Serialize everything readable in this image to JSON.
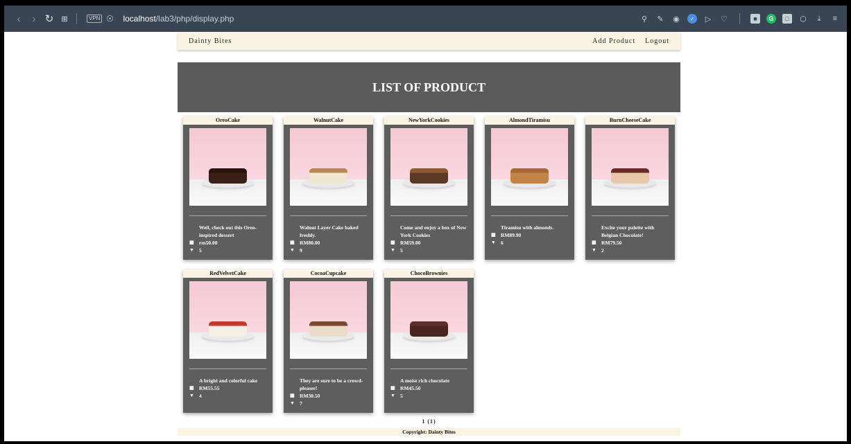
{
  "browser": {
    "url_host": "localhost",
    "url_path": "/lab3/php/display.php",
    "vpn_label": "VPN"
  },
  "nav": {
    "brand": "Dainty Bites",
    "add_product": "Add Product",
    "logout": "Logout"
  },
  "banner": {
    "title": "LIST OF PRODUCT"
  },
  "products": [
    {
      "name": "OreoCake",
      "desc": "Well, check out this Oreo-inspired dessert",
      "price": "rm50.00",
      "qty": "5",
      "cake_color": "#3b1f17",
      "cake_top": "#2a140e"
    },
    {
      "name": "WalnutCake",
      "desc": "Walnut Layer Cake baked freshly.",
      "price": "RM80.00",
      "qty": "9",
      "cake_color": "#efe7d3",
      "cake_top": "#b98a4f"
    },
    {
      "name": "NewYorkCookies",
      "desc": "Come and enjoy a box of New York Cookies",
      "price": "RM59.00",
      "qty": "5",
      "cake_color": "#5a3a25",
      "cake_top": "#8c5a2e"
    },
    {
      "name": "AlmondTiramisu",
      "desc": "Tiramisu with almonds.",
      "price": "RM89.90",
      "qty": "6",
      "cake_color": "#c08448",
      "cake_top": "#a8682f"
    },
    {
      "name": "BurnCheeseCake",
      "desc": "Excite your palette with Belgian Chocolate!",
      "price": "RM79.50",
      "qty": "2",
      "cake_color": "#e8c8a8",
      "cake_top": "#6b2a22"
    },
    {
      "name": "RedVelvetCake",
      "desc": "A bright and colorful cake",
      "price": "RM55.55",
      "qty": "4",
      "cake_color": "#f7efe6",
      "cake_top": "#c23a2e"
    },
    {
      "name": "CocoaCupcake",
      "desc": "They are sure to be a crowd-pleaser!",
      "price": "RM30.50",
      "qty": "7",
      "cake_color": "#e9dcc9",
      "cake_top": "#7a4b33"
    },
    {
      "name": "ChocoBrownies",
      "desc": "A moist rich chocolate",
      "price": "RM45.50",
      "qty": "5",
      "cake_color": "#4a241e",
      "cake_top": "#5e2f28"
    }
  ],
  "pager": "1 (1)",
  "footer": "Copyright: Dainty Bites"
}
